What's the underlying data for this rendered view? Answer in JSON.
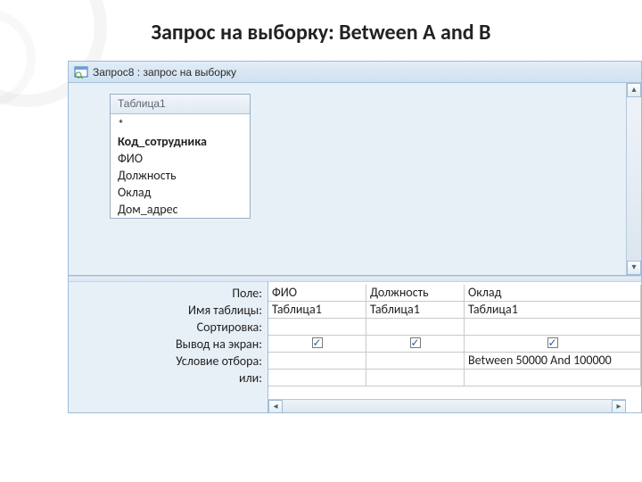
{
  "slide": {
    "heading": "Запрос на выборку: Between A and B"
  },
  "window": {
    "title": "Запрос8 : запрос на выборку"
  },
  "fieldList": {
    "tableName": "Таблица1",
    "items": {
      "star": "*",
      "pk": "Код_сотрудника",
      "f1": "ФИО",
      "f2": "Должность",
      "f3": "Оклад",
      "f4": "Дом_адрес"
    }
  },
  "designer": {
    "labels": {
      "field": "Поле:",
      "table": "Имя таблицы:",
      "sort": "Сортировка:",
      "show": "Вывод на экран:",
      "criteria": "Условие отбора:",
      "or": "или:"
    },
    "cols": [
      {
        "field": "ФИО",
        "table": "Таблица1",
        "sort": "",
        "show": true,
        "criteria": "",
        "or": ""
      },
      {
        "field": "Должность",
        "table": "Таблица1",
        "sort": "",
        "show": true,
        "criteria": "",
        "or": ""
      },
      {
        "field": "Оклад",
        "table": "Таблица1",
        "sort": "",
        "show": true,
        "criteria": "Between 50000 And 100000",
        "or": ""
      }
    ]
  }
}
